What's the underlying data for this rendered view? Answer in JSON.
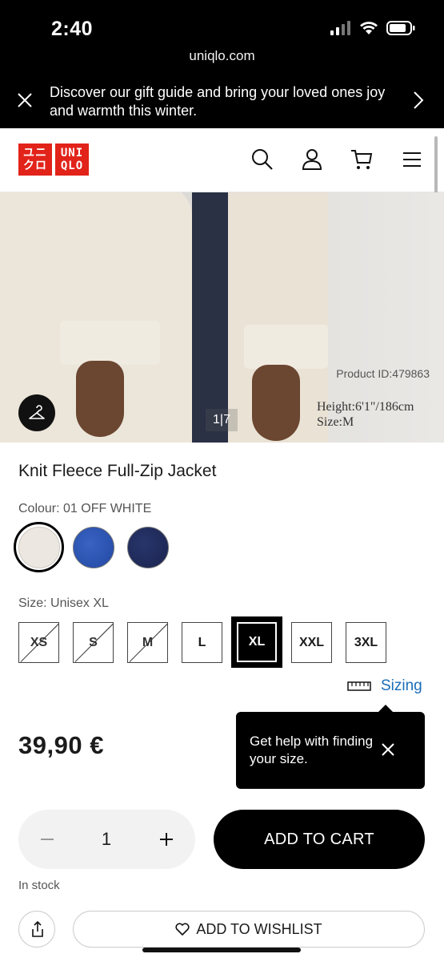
{
  "status_bar": {
    "time": "2:40",
    "url": "uniqlo.com"
  },
  "promo": {
    "text": "Discover our gift guide and bring your loved ones joy and warmth this winter."
  },
  "header": {
    "logo_top": "ユニ UNI",
    "logo_bottom": "クロ QLO",
    "logo_box1_line1": "ユニ",
    "logo_box1_line2": "クロ",
    "logo_box2_line1": "UNI",
    "logo_box2_line2": "QLO",
    "icons": [
      "search-icon",
      "account-icon",
      "cart-icon",
      "menu-icon"
    ]
  },
  "gallery": {
    "product_id": "Product ID:479863",
    "model_height": "Height:6'1\"/186cm",
    "model_size": "Size:M",
    "counter": "1|7"
  },
  "product": {
    "title": "Knit Fleece Full-Zip Jacket",
    "colour_label": "Colour: 01 OFF WHITE",
    "colours": [
      {
        "name": "off-white",
        "hex": "#ece8e1",
        "selected": true
      },
      {
        "name": "blue",
        "hex": "#2a55b3",
        "selected": false
      },
      {
        "name": "navy",
        "hex": "#1e2a55",
        "selected": false
      }
    ],
    "size_label": "Size: Unisex XL",
    "sizes": [
      {
        "label": "XS",
        "available": false,
        "selected": false
      },
      {
        "label": "S",
        "available": false,
        "selected": false
      },
      {
        "label": "M",
        "available": false,
        "selected": false
      },
      {
        "label": "L",
        "available": true,
        "selected": false
      },
      {
        "label": "XL",
        "available": true,
        "selected": true
      },
      {
        "label": "XXL",
        "available": true,
        "selected": false
      },
      {
        "label": "3XL",
        "available": true,
        "selected": false
      }
    ],
    "sizing_link": "Sizing",
    "price": "39,90 €"
  },
  "tooltip": {
    "text": "Get help with finding your size."
  },
  "cart": {
    "quantity": "1",
    "add_to_cart": "ADD TO CART",
    "stock": "In stock",
    "wishlist": "ADD TO WISHLIST"
  },
  "colors": {
    "brand_red": "#e2231a",
    "link_blue": "#1b6cb8",
    "black": "#000000"
  }
}
